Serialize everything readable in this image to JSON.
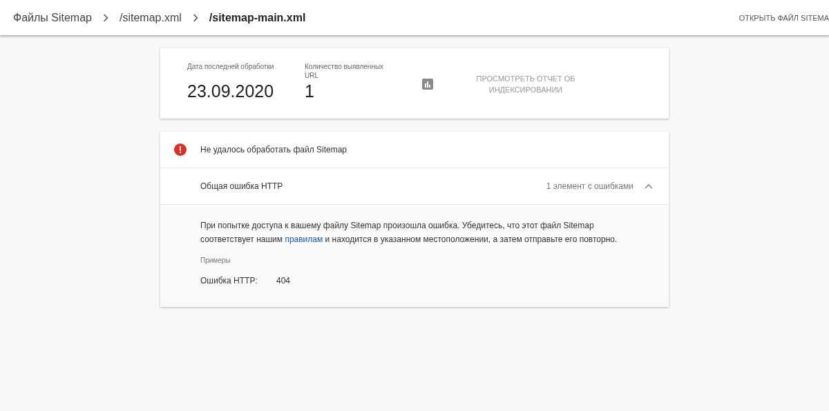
{
  "breadcrumbs": [
    {
      "label": "Файлы Sitemap",
      "current": false
    },
    {
      "label": "/sitemap.xml",
      "current": false
    },
    {
      "label": "/sitemap-main.xml",
      "current": true
    }
  ],
  "header_action": "ОТКРЫТЬ ФАЙЛ SITEMA",
  "summary": {
    "stats": [
      {
        "label": "Дата последней обработки",
        "value": "23.09.2020"
      },
      {
        "label": "Количество выявленных URL",
        "value": "1"
      }
    ],
    "report_link": "ПРОСМОТРЕТЬ ОТЧЕТ ОБ ИНДЕКСИРОВАНИИ"
  },
  "status": {
    "kind": "error",
    "message": "Не удалось обработать файл Sitemap"
  },
  "issue": {
    "title": "Общая ошибка HTTP",
    "count": "1 элемент с ошибками",
    "expanded": true,
    "description": {
      "before": "При попытке доступа к вашему файлу Sitemap произошла ошибка. Убедитесь, что этот файл Sitemap соответствует нашим ",
      "link": "правилам",
      "after": " и находится в указанном местоположении, а затем отправьте его повторно."
    },
    "examples_label": "Примеры",
    "examples": [
      {
        "key": "Ошибка HTTP:",
        "value": "404"
      }
    ]
  }
}
